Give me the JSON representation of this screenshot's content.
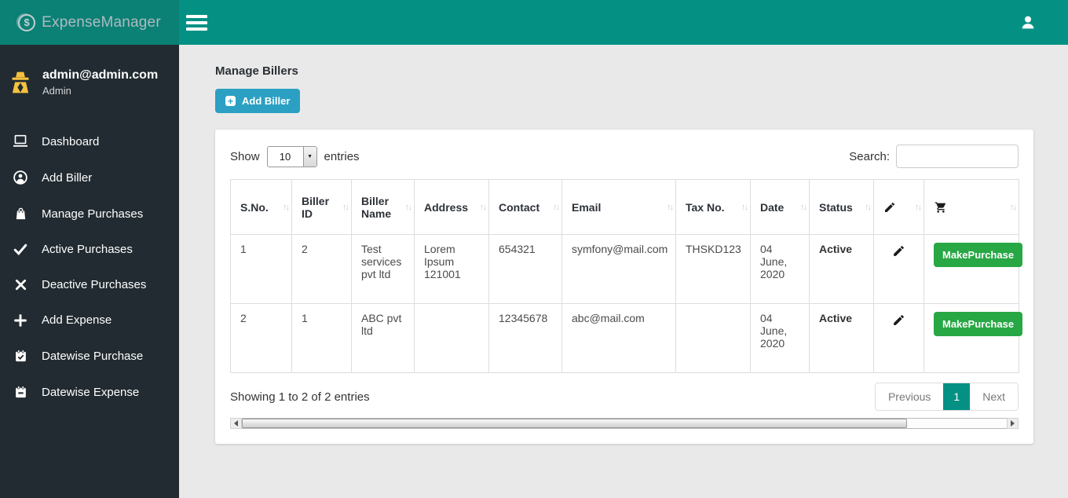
{
  "brand": {
    "name": "ExpenseManager",
    "logo_symbol": "$"
  },
  "user": {
    "email": "admin@admin.com",
    "role": "Admin"
  },
  "sidebar": {
    "items": [
      {
        "label": "Dashboard"
      },
      {
        "label": "Add Biller"
      },
      {
        "label": "Manage Purchases"
      },
      {
        "label": "Active Purchases"
      },
      {
        "label": "Deactive Purchases"
      },
      {
        "label": "Add Expense"
      },
      {
        "label": "Datewise Purchase"
      },
      {
        "label": "Datewise Expense"
      }
    ]
  },
  "page": {
    "title": "Manage Billers",
    "add_button": "Add Biller"
  },
  "controls": {
    "show_label": "Show",
    "page_length": "10",
    "entries_label": "entries",
    "search_label": "Search:",
    "search_value": ""
  },
  "table": {
    "columns": {
      "sno": "S.No.",
      "biller_id": "Biller ID",
      "name": "Biller Name",
      "address": "Address",
      "contact": "Contact",
      "email": "Email",
      "tax": "Tax No.",
      "date": "Date",
      "status": "Status"
    },
    "rows": [
      {
        "sno": "1",
        "biller_id": "2",
        "name": "Test services pvt ltd",
        "address": "Lorem Ipsum 121001",
        "contact": "654321",
        "email": "symfony@mail.com",
        "tax": "THSKD123",
        "date": "04 June, 2020",
        "status": "Active",
        "action": "MakePurchase"
      },
      {
        "sno": "2",
        "biller_id": "1",
        "name": "ABC pvt ltd",
        "address": "",
        "contact": "12345678",
        "email": "abc@mail.com",
        "tax": "",
        "date": "04 June, 2020",
        "status": "Active",
        "action": "MakePurchase"
      }
    ]
  },
  "footer": {
    "info": "Showing 1 to 2 of 2 entries",
    "previous": "Previous",
    "current_page": "1",
    "next": "Next"
  },
  "ui": {
    "sort_icon": "↑↓",
    "plus_glyph": "+",
    "select_arrow": "▼"
  },
  "colors": {
    "topbar_teal": "#049184",
    "brand_teal_dark": "#0b8075",
    "sidebar_dark": "#222b31",
    "add_button_blue": "#2ba0c2",
    "make_purchase_green": "#28a745",
    "pagination_active_teal": "#049184",
    "content_background": "#e9e9e9",
    "spy_icon_yellow": "#f6c23e"
  }
}
